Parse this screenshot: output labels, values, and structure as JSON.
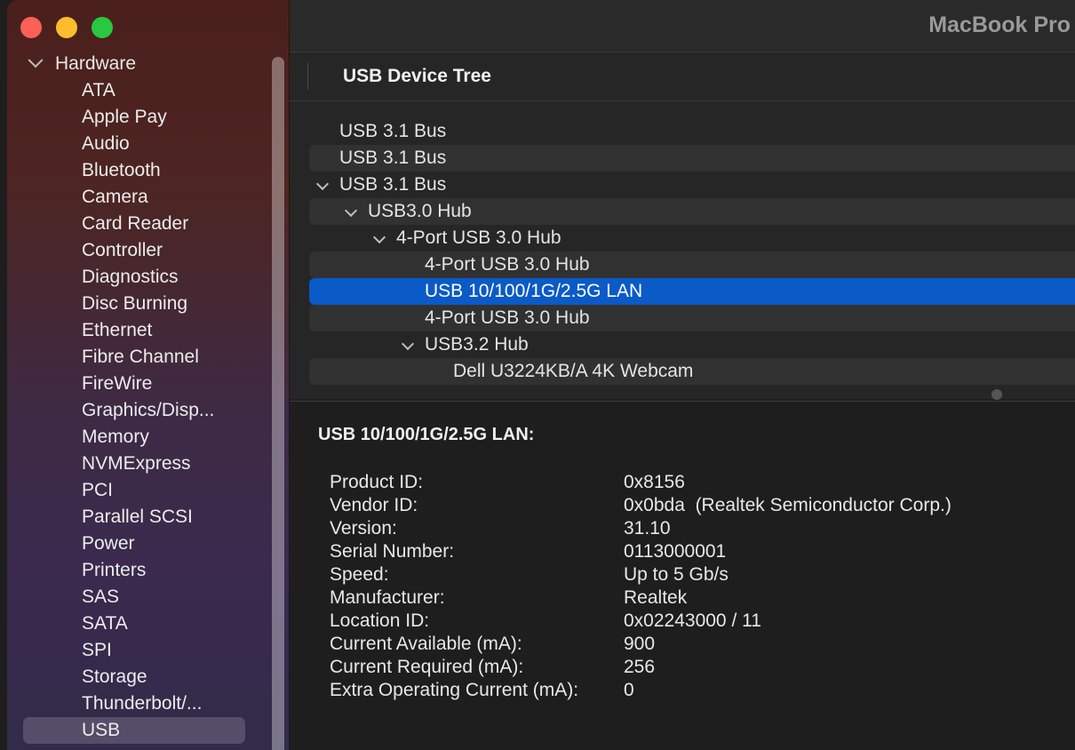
{
  "window": {
    "title": "MacBook Pro"
  },
  "sidebar": {
    "section_label": "Hardware",
    "items": [
      {
        "label": "ATA"
      },
      {
        "label": "Apple Pay"
      },
      {
        "label": "Audio"
      },
      {
        "label": "Bluetooth"
      },
      {
        "label": "Camera"
      },
      {
        "label": "Card Reader"
      },
      {
        "label": "Controller"
      },
      {
        "label": "Diagnostics"
      },
      {
        "label": "Disc Burning"
      },
      {
        "label": "Ethernet"
      },
      {
        "label": "Fibre Channel"
      },
      {
        "label": "FireWire"
      },
      {
        "label": "Graphics/Disp..."
      },
      {
        "label": "Memory"
      },
      {
        "label": "NVMExpress"
      },
      {
        "label": "PCI"
      },
      {
        "label": "Parallel SCSI"
      },
      {
        "label": "Power"
      },
      {
        "label": "Printers"
      },
      {
        "label": "SAS"
      },
      {
        "label": "SATA"
      },
      {
        "label": "SPI"
      },
      {
        "label": "Storage"
      },
      {
        "label": "Thunderbolt/..."
      },
      {
        "label": "USB",
        "selected": true
      }
    ]
  },
  "tree": {
    "title": "USB Device Tree",
    "rows": [
      {
        "label": "USB 3.1 Bus",
        "level": 0,
        "expanded": false
      },
      {
        "label": "USB 3.1 Bus",
        "level": 0,
        "expanded": false
      },
      {
        "label": "USB 3.1 Bus",
        "level": 0,
        "expanded": true
      },
      {
        "label": "USB3.0 Hub",
        "level": 1,
        "expanded": true
      },
      {
        "label": "4-Port USB 3.0 Hub",
        "level": 2,
        "expanded": true
      },
      {
        "label": "4-Port USB 3.0 Hub",
        "level": 3,
        "expanded": false
      },
      {
        "label": "USB 10/100/1G/2.5G LAN",
        "level": 3,
        "expanded": false,
        "selected": true
      },
      {
        "label": "4-Port USB 3.0 Hub",
        "level": 3,
        "expanded": false
      },
      {
        "label": "USB3.2 Hub",
        "level": 3,
        "expanded": true
      },
      {
        "label": "Dell U3224KB/A 4K Webcam",
        "level": 4,
        "expanded": false
      }
    ]
  },
  "details": {
    "title": "USB 10/100/1G/2.5G LAN:",
    "properties": [
      {
        "key": "Product ID:",
        "value": "0x8156"
      },
      {
        "key": "Vendor ID:",
        "value": "0x0bda  (Realtek Semiconductor Corp.)"
      },
      {
        "key": "Version:",
        "value": "31.10"
      },
      {
        "key": "Serial Number:",
        "value": "0113000001"
      },
      {
        "key": "Speed:",
        "value": "Up to 5 Gb/s"
      },
      {
        "key": "Manufacturer:",
        "value": "Realtek"
      },
      {
        "key": "Location ID:",
        "value": "0x02243000 / 11"
      },
      {
        "key": "Current Available (mA):",
        "value": "900"
      },
      {
        "key": "Current Required (mA):",
        "value": "256"
      },
      {
        "key": "Extra Operating Current (mA):",
        "value": "0"
      }
    ]
  }
}
